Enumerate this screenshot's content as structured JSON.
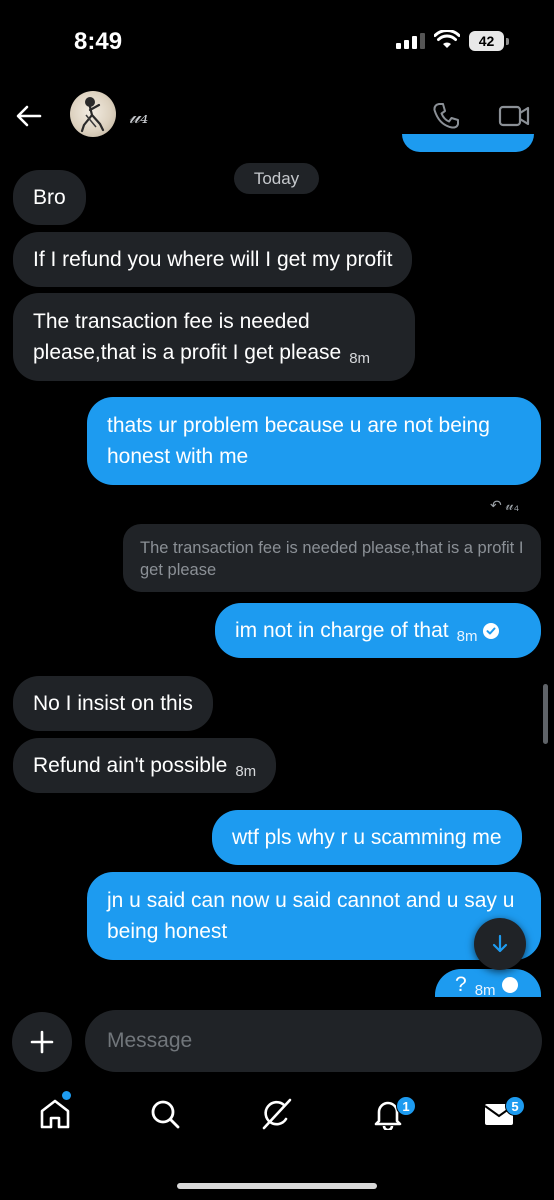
{
  "status_bar": {
    "time": "8:49",
    "battery": "42"
  },
  "header": {
    "contact_name": "𝓊₄"
  },
  "chat": {
    "day_label": "Today",
    "messages": [
      {
        "dir": "in",
        "text": "Bro",
        "time": ""
      },
      {
        "dir": "in",
        "text": "If I refund you where will I get my profit",
        "time": ""
      },
      {
        "dir": "in",
        "text": "The transaction fee is needed please,that is a profit I get please",
        "time": "8m"
      },
      {
        "dir": "out",
        "text": "thats ur problem because u are not being honest with me",
        "time": ""
      },
      {
        "dir": "out",
        "text": "im not in charge of that",
        "time": "8m"
      },
      {
        "dir": "in",
        "text": "No I insist on this",
        "time": ""
      },
      {
        "dir": "in",
        "text": "Refund ain't possible",
        "time": "8m"
      },
      {
        "dir": "out",
        "text": "wtf pls why r u scamming me",
        "time": ""
      },
      {
        "dir": "out",
        "text": "jn u said can now u said cannot and u say u being honest",
        "time": ""
      },
      {
        "dir": "out",
        "text": "?",
        "time": "8m"
      }
    ],
    "reply_meta": "𝓊₄",
    "reply_quote": "The transaction fee is needed please,that is a profit I get please"
  },
  "composer": {
    "placeholder": "Message"
  },
  "nav": {
    "notifications_badge": "1",
    "messages_badge": "5"
  },
  "colors": {
    "accent": "#1d9bf0",
    "incoming_bubble": "#202327",
    "background": "#000000"
  },
  "icons": [
    "back-arrow-icon",
    "phone-icon",
    "video-camera-icon",
    "plus-icon",
    "arrow-down-icon",
    "home-icon",
    "search-icon",
    "grok-icon",
    "bell-icon",
    "envelope-icon",
    "check-circle-icon"
  ]
}
